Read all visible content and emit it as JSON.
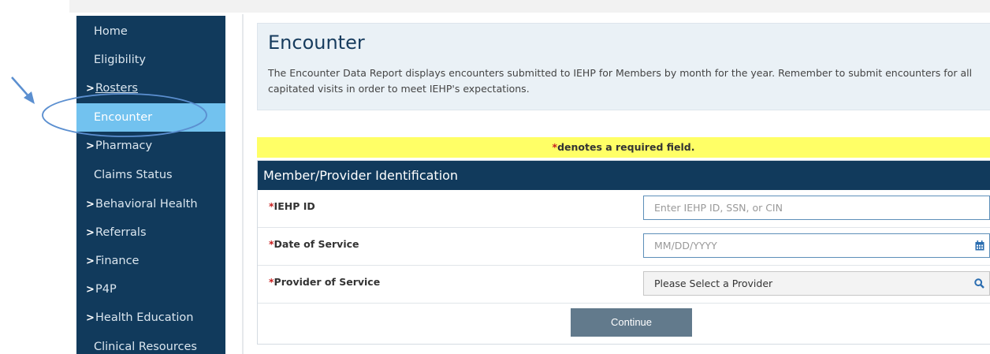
{
  "sidebar": {
    "items": [
      {
        "label": "Home",
        "chevron": ""
      },
      {
        "label": "Eligibility",
        "chevron": ""
      },
      {
        "label": "Rosters",
        "chevron": ">"
      },
      {
        "label": "Encounter",
        "chevron": ""
      },
      {
        "label": "Pharmacy",
        "chevron": ">"
      },
      {
        "label": "Claims Status",
        "chevron": ""
      },
      {
        "label": "Behavioral Health",
        "chevron": ">"
      },
      {
        "label": "Referrals",
        "chevron": ">"
      },
      {
        "label": "Finance",
        "chevron": ">"
      },
      {
        "label": "P4P",
        "chevron": ">"
      },
      {
        "label": "Health Education",
        "chevron": ">"
      },
      {
        "label": "Clinical Resources",
        "chevron": ""
      }
    ],
    "active": "Encounter",
    "active_color": "#72c2ef",
    "bg_color": "#113a5c"
  },
  "annotation": {
    "color": "#5b8fd0"
  },
  "hero": {
    "title": "Encounter",
    "description": "The Encounter Data Report displays encounters submitted to IEHP for Members by month for the year. Remember to submit encounters for all capitated visits in order to meet IEHP's expectations."
  },
  "required_note": {
    "star": "*",
    "text": "denotes a required field."
  },
  "form": {
    "title": "Member/Provider Identification",
    "fields": [
      {
        "star": "*",
        "label": "IEHP ID",
        "placeholder": "Enter IEHP ID, SSN, or CIN",
        "icon": ""
      },
      {
        "star": "*",
        "label": "Date of Service",
        "placeholder": "MM/DD/YYYY",
        "icon": "calendar-icon"
      },
      {
        "star": "*",
        "label": "Provider of Service",
        "value": "Please Select a Provider",
        "icon": "search-icon"
      }
    ],
    "continue_label": "Continue"
  }
}
